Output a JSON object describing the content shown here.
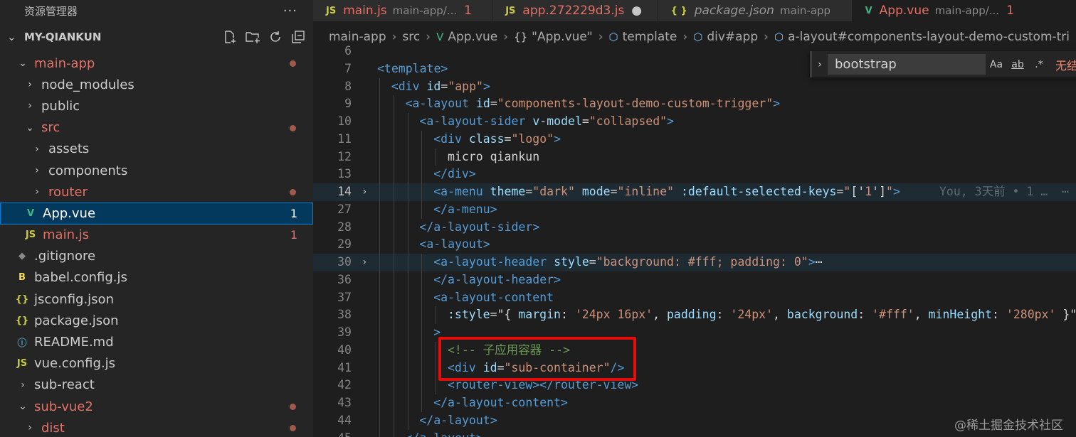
{
  "sidebar": {
    "title": "资源管理器",
    "more": "···",
    "section": "MY-QIANKUN",
    "items": [
      {
        "label": "main-app",
        "chev": "⌄",
        "icon": "",
        "dot": true,
        "num": "",
        "mod": true
      },
      {
        "label": "node_modules",
        "chev": "›",
        "icon": "",
        "dot": false,
        "num": "",
        "mod": false
      },
      {
        "label": "public",
        "chev": "›",
        "icon": "",
        "dot": false,
        "num": "",
        "mod": false
      },
      {
        "label": "src",
        "chev": "⌄",
        "icon": "",
        "dot": true,
        "num": "",
        "mod": true
      },
      {
        "label": "assets",
        "chev": "›",
        "icon": "",
        "dot": false,
        "num": "",
        "mod": false
      },
      {
        "label": "components",
        "chev": "›",
        "icon": "",
        "dot": false,
        "num": "",
        "mod": false
      },
      {
        "label": "router",
        "chev": "›",
        "icon": "",
        "dot": true,
        "num": "",
        "mod": true
      },
      {
        "label": "App.vue",
        "chev": "",
        "icon": "vue-icon",
        "dot": false,
        "num": "1",
        "mod": true,
        "selected": true
      },
      {
        "label": "main.js",
        "chev": "",
        "icon": "js-icon",
        "dot": false,
        "num": "1",
        "mod": true
      },
      {
        "label": ".gitignore",
        "chev": "",
        "icon": "git-icon",
        "dot": false,
        "num": "",
        "mod": false
      },
      {
        "label": "babel.config.js",
        "chev": "",
        "icon": "babel-icon",
        "dot": false,
        "num": "",
        "mod": false
      },
      {
        "label": "jsconfig.json",
        "chev": "",
        "icon": "json-icon",
        "dot": false,
        "num": "",
        "mod": false
      },
      {
        "label": "package.json",
        "chev": "",
        "icon": "json-icon",
        "dot": false,
        "num": "",
        "mod": false
      },
      {
        "label": "README.md",
        "chev": "",
        "icon": "info-icon",
        "dot": false,
        "num": "",
        "mod": false
      },
      {
        "label": "vue.config.js",
        "chev": "",
        "icon": "js-icon",
        "dot": false,
        "num": "",
        "mod": false
      },
      {
        "label": "sub-react",
        "chev": "›",
        "icon": "",
        "dot": false,
        "num": "",
        "mod": false
      },
      {
        "label": "sub-vue2",
        "chev": "⌄",
        "icon": "",
        "dot": true,
        "num": "",
        "mod": true
      },
      {
        "label": "dist",
        "chev": "›",
        "icon": "",
        "dot": true,
        "num": "",
        "mod": true
      }
    ]
  },
  "tabs": [
    {
      "tag": "JS",
      "name": "main.js",
      "desc": "main-app/...",
      "badge": "1",
      "err": true,
      "active": false
    },
    {
      "tag": "JS",
      "name": "app.272229d3.js",
      "desc": "",
      "badge": "●",
      "err": true,
      "active": false
    },
    {
      "tag": "{ }",
      "name": "package.json",
      "desc": "main-app",
      "badge": "",
      "err": false,
      "active": false
    },
    {
      "tag": "V",
      "name": "App.vue",
      "desc": "main-app/...",
      "badge": "1",
      "err": true,
      "active": true
    }
  ],
  "breadcrumb": [
    "main-app",
    "src",
    "App.vue",
    "\"App.vue\"",
    "template",
    "div#app",
    "a-layout#components-layout-demo-custom-tri"
  ],
  "find": {
    "query": "bootstrap",
    "case": "Aa",
    "word": "ab",
    "regex": ".*",
    "result": "无结"
  },
  "editor": {
    "blame": "You, 3天前 • 1 …"
  },
  "watermark": "@稀土掘金技术社区",
  "colors": {
    "accent": "#007fd4",
    "modified": "#e37165",
    "highlight_box": "#e30d0d"
  }
}
